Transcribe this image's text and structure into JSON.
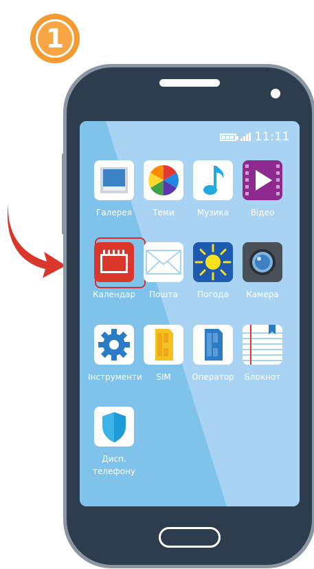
{
  "step": {
    "number": "1"
  },
  "status_bar": {
    "time": "11:11"
  },
  "apps": [
    {
      "name": "gallery",
      "label": "Галерея"
    },
    {
      "name": "themes",
      "label": "Теми"
    },
    {
      "name": "music",
      "label": "Музика"
    },
    {
      "name": "video",
      "label": "Відео"
    },
    {
      "name": "calendar",
      "label": "Календар",
      "selected": true
    },
    {
      "name": "mail",
      "label": "Пошта"
    },
    {
      "name": "weather",
      "label": "Погода"
    },
    {
      "name": "camera",
      "label": "Камера"
    },
    {
      "name": "tools",
      "label": "Інструменти"
    },
    {
      "name": "sim",
      "label": "SIM"
    },
    {
      "name": "operator",
      "label": "Оператор"
    },
    {
      "name": "notepad",
      "label": "Блокнот"
    },
    {
      "name": "phone-manager",
      "label_line1": "Дисп.",
      "label_line2": "телефону"
    }
  ],
  "colors": {
    "accent_orange": "#f39a32",
    "arrow_red": "#d9372b",
    "phone_body": "#2e3d4d",
    "screen_blue": "#a9d3f2",
    "selection_red": "#d62b2b"
  },
  "icons": [
    "gallery-icon",
    "themes-icon",
    "music-icon",
    "video-icon",
    "calendar-icon",
    "mail-icon",
    "weather-icon",
    "camera-icon",
    "tools-icon",
    "sim-icon",
    "operator-icon",
    "notepad-icon",
    "shield-icon",
    "battery-icon",
    "signal-icon"
  ]
}
